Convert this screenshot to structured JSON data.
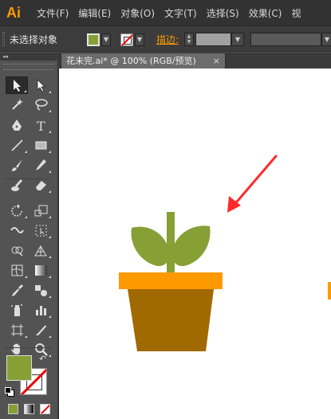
{
  "app": {
    "logo": "Ai"
  },
  "menu": [
    {
      "label": "文件(F)"
    },
    {
      "label": "编辑(E)"
    },
    {
      "label": "对象(O)"
    },
    {
      "label": "文字(T)"
    },
    {
      "label": "选择(S)"
    },
    {
      "label": "效果(C)"
    },
    {
      "label": "视"
    }
  ],
  "control_bar": {
    "selection_label": "未选择对象",
    "stroke_label": "描边:",
    "fill_color": "#86a036",
    "stroke_color": "none"
  },
  "toolbox": {
    "collapse_glyph": "◂◂",
    "tools": [
      {
        "name": "selection-tool-icon",
        "active": true
      },
      {
        "name": "direct-selection-tool-icon"
      },
      {
        "name": "magic-wand-tool-icon"
      },
      {
        "name": "lasso-tool-icon"
      },
      {
        "name": "pen-tool-icon"
      },
      {
        "name": "type-tool-icon"
      },
      {
        "name": "line-segment-tool-icon"
      },
      {
        "name": "rectangle-tool-icon"
      },
      {
        "name": "paintbrush-tool-icon"
      },
      {
        "name": "pencil-tool-icon"
      },
      {
        "name": "blob-brush-tool-icon"
      },
      {
        "name": "eraser-tool-icon"
      },
      {
        "name": "rotate-tool-icon"
      },
      {
        "name": "scale-tool-icon"
      },
      {
        "name": "width-tool-icon"
      },
      {
        "name": "free-transform-tool-icon"
      },
      {
        "name": "shape-builder-tool-icon"
      },
      {
        "name": "perspective-grid-tool-icon"
      },
      {
        "name": "mesh-tool-icon"
      },
      {
        "name": "gradient-tool-icon"
      },
      {
        "name": "eyedropper-tool-icon"
      },
      {
        "name": "blend-tool-icon"
      },
      {
        "name": "symbol-sprayer-tool-icon"
      },
      {
        "name": "column-graph-tool-icon"
      },
      {
        "name": "artboard-tool-icon"
      },
      {
        "name": "slice-tool-icon"
      },
      {
        "name": "hand-tool-icon"
      },
      {
        "name": "zoom-tool-icon"
      }
    ],
    "fill_color": "#86a036",
    "swap_glyph": "↶"
  },
  "document": {
    "tab_title": "花未完.ai* @ 100% (RGB/预览)",
    "close_glyph": "×"
  },
  "artwork": {
    "stem_color": "#86a036",
    "leaf_color": "#86a036",
    "rim_color": "#ff9900",
    "pot_color": "#a06a00",
    "arrow_color": "#ff2b2b",
    "edge_mark_color": "#ff9900"
  }
}
